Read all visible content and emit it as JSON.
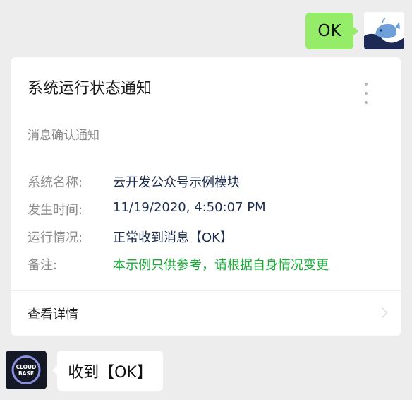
{
  "outgoing": {
    "text": "OK"
  },
  "card": {
    "title": "系统运行状态通知",
    "subtitle": "消息确认通知",
    "fields": [
      {
        "label": "系统名称:",
        "value": "云开发公众号示例模块"
      },
      {
        "label": "发生时间:",
        "value": "11/19/2020, 4:50:07 PM"
      },
      {
        "label": "运行情况:",
        "value": "正常收到消息【OK】"
      },
      {
        "label": "备注:",
        "value": "本示例只供参考，请根据自身情况变更"
      }
    ],
    "detail_label": "查看详情"
  },
  "incoming": {
    "avatar_text_line1": "CLOUD",
    "avatar_text_line2": "BASE",
    "text": "收到【OK】"
  },
  "colors": {
    "background": "#ededed",
    "outgoing_bubble": "#95ec69",
    "remark_green": "#19ad38",
    "value_blue": "#1c2d4f"
  },
  "icons": {
    "right_avatar": "whale-avatar-icon",
    "left_avatar": "cloudbase-logo-icon",
    "more": "more-vertical-icon",
    "detail_arrow": "chevron-right-icon"
  }
}
